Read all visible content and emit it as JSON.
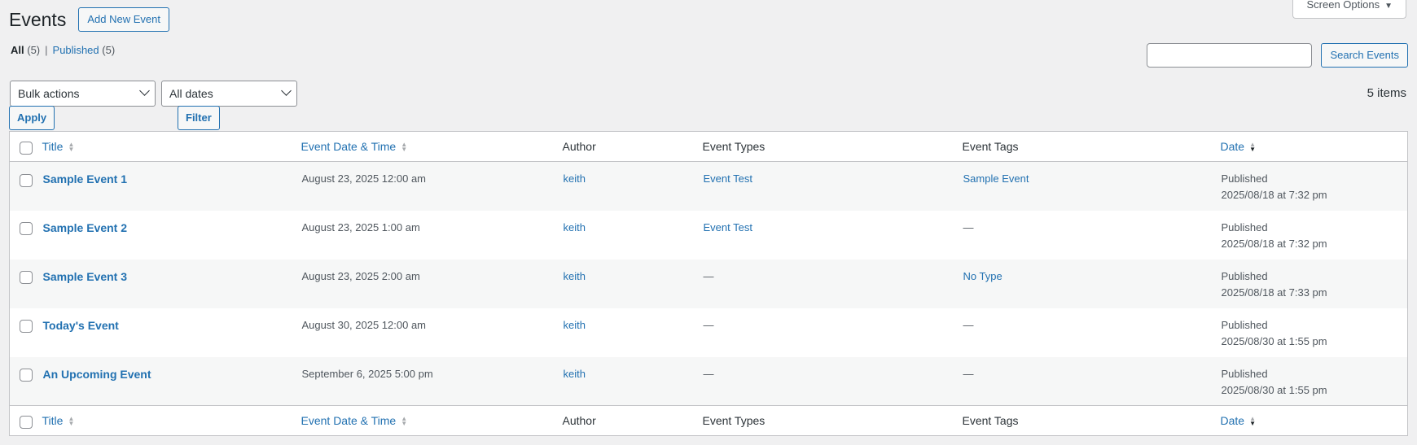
{
  "header": {
    "title": "Events",
    "add_new_label": "Add New Event",
    "screen_options_label": "Screen Options"
  },
  "views": [
    {
      "label": "All",
      "count": "(5)"
    },
    {
      "label": "Published",
      "count": "(5)"
    }
  ],
  "views_separator": "|",
  "search": {
    "placeholder": "",
    "button_label": "Search Events"
  },
  "filters": {
    "bulk_actions": "Bulk actions",
    "apply_label": "Apply",
    "dates": "All dates",
    "filter_label": "Filter"
  },
  "items_count": "5 items",
  "columns": {
    "title": "Title",
    "event_date": "Event Date & Time",
    "author": "Author",
    "event_types": "Event Types",
    "event_tags": "Event Tags",
    "date": "Date"
  },
  "rows": [
    {
      "title": "Sample Event 1",
      "event_date": "August 23, 2025 12:00 am",
      "author": "keith",
      "event_types": "Event Test",
      "event_tags": "Sample Event",
      "status": "Published",
      "date": "2025/08/18 at 7:32 pm"
    },
    {
      "title": "Sample Event 2",
      "event_date": "August 23, 2025 1:00 am",
      "author": "keith",
      "event_types": "Event Test",
      "event_tags": "—",
      "status": "Published",
      "date": "2025/08/18 at 7:32 pm"
    },
    {
      "title": "Sample Event 3",
      "event_date": "August 23, 2025 2:00 am",
      "author": "keith",
      "event_types": "—",
      "event_tags": "No Type",
      "status": "Published",
      "date": "2025/08/18 at 7:33 pm"
    },
    {
      "title": "Today's Event",
      "event_date": "August 30, 2025 12:00 am",
      "author": "keith",
      "event_types": "—",
      "event_tags": "—",
      "status": "Published",
      "date": "2025/08/30 at 1:55 pm"
    },
    {
      "title": "An Upcoming Event",
      "event_date": "September 6, 2025 5:00 pm",
      "author": "keith",
      "event_types": "—",
      "event_tags": "—",
      "status": "Published",
      "date": "2025/08/30 at 1:55 pm"
    }
  ],
  "colors": {
    "link": "#2271b1",
    "text": "#1d2327",
    "border": "#c3c4c7",
    "background": "#f0f0f1"
  }
}
